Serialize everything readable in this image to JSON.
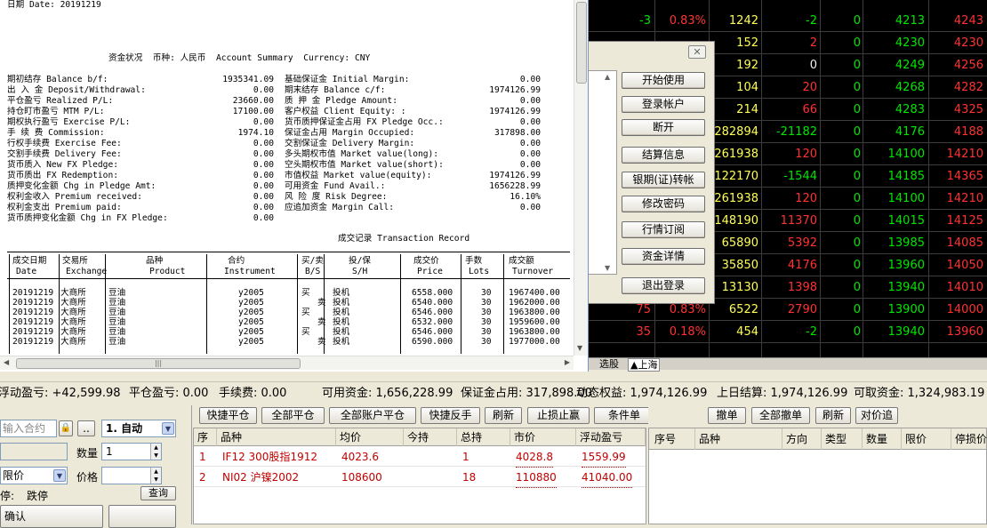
{
  "quote": {
    "rows": [
      [
        "",
        "-3",
        "0.83%",
        "1242",
        "-2",
        "0",
        "4213",
        "4243"
      ],
      [
        "",
        "",
        "",
        "152",
        "2",
        "0",
        "4230",
        "4230"
      ],
      [
        "",
        "",
        "",
        "192",
        "0",
        "0",
        "4249",
        "4256"
      ],
      [
        "",
        "",
        "",
        "104",
        "20",
        "0",
        "4268",
        "4282"
      ],
      [
        "",
        "",
        "",
        "214",
        "66",
        "0",
        "4283",
        "4325"
      ],
      [
        "",
        "",
        "",
        "282894",
        "-21182",
        "0",
        "4176",
        "4188"
      ],
      [
        "",
        "",
        "",
        "261938",
        "120",
        "0",
        "14100",
        "14210"
      ],
      [
        "",
        "",
        "",
        "122170",
        "-1544",
        "0",
        "14185",
        "14365"
      ],
      [
        "",
        "",
        "",
        "261938",
        "120",
        "0",
        "14100",
        "14210"
      ],
      [
        "",
        "",
        "",
        "148190",
        "11370",
        "0",
        "14015",
        "14125"
      ],
      [
        "",
        "",
        "",
        "65890",
        "5392",
        "0",
        "13985",
        "14085"
      ],
      [
        "",
        "",
        "",
        "35850",
        "4176",
        "0",
        "13960",
        "14050"
      ],
      [
        "",
        "",
        "",
        "13130",
        "1398",
        "0",
        "13940",
        "14010"
      ],
      [
        "",
        "75",
        "0.83%",
        "6522",
        "2790",
        "0",
        "13900",
        "14000"
      ],
      [
        "",
        "35",
        "0.18%",
        "454",
        "-2",
        "0",
        "13940",
        "13960"
      ]
    ],
    "tabs": [
      "选股",
      "▲上海"
    ]
  },
  "report": {
    "header": "日期 Date: 20191219",
    "summary_title": "资金状况  币种: 人民币  Account Summary  Currency: CNY",
    "left": [
      [
        "期初结存 Balance b/f:",
        "1935341.09"
      ],
      [
        "出 入 金 Deposit/Withdrawal:",
        "0.00"
      ],
      [
        "平仓盈亏 Realized P/L:",
        "23660.00"
      ],
      [
        "持仓盯市盈亏 MTM P/L:",
        "17100.00"
      ],
      [
        "期权执行盈亏 Exercise P/L:",
        "0.00"
      ],
      [
        "手 续 费 Commission:",
        "1974.10"
      ],
      [
        "行权手续费 Exercise Fee:",
        "0.00"
      ],
      [
        "交割手续费 Delivery Fee:",
        "0.00"
      ],
      [
        "货币质入 New FX Pledge:",
        "0.00"
      ],
      [
        "货币质出 FX Redemption:",
        "0.00"
      ],
      [
        "质押变化金额 Chg in Pledge Amt:",
        "0.00"
      ],
      [
        "权利金收入 Premium received:",
        "0.00"
      ],
      [
        "权利金支出 Premium paid:",
        "0.00"
      ],
      [
        "货币质押变化金额 Chg in FX Pledge:",
        "0.00"
      ]
    ],
    "right": [
      [
        "基础保证金 Initial Margin:",
        "0.00"
      ],
      [
        "期末结存 Balance c/f:",
        "1974126.99"
      ],
      [
        "质 押 金 Pledge Amount:",
        "0.00"
      ],
      [
        "客户权益 Client Equity: :",
        "1974126.99"
      ],
      [
        "货币质押保证金占用 FX Pledge Occ.:",
        "0.00"
      ],
      [
        "保证金占用 Margin Occupied:",
        "317898.00"
      ],
      [
        "交割保证金 Delivery Margin:",
        "0.00"
      ],
      [
        "多头期权市值 Market value(long):",
        "0.00"
      ],
      [
        "空头期权市值 Market value(short):",
        "0.00"
      ],
      [
        "市值权益 Market value(equity):",
        "1974126.99"
      ],
      [
        "可用资金 Fund Avail.:",
        "1656228.99"
      ],
      [
        "风 险 度 Risk Degree:",
        "16.10%"
      ],
      [
        "应追加资金 Margin Call:",
        "0.00"
      ]
    ],
    "trade_title": "成交记录 Transaction Record",
    "cols_cn": [
      "成交日期",
      "交易所",
      "品种",
      "合约",
      "买/卖",
      "投/保",
      "成交价",
      "手数",
      "成交额"
    ],
    "cols_en": [
      "Date",
      "Exchange",
      "Product",
      "Instrument",
      "B/S",
      "S/H",
      "Price",
      "Lots",
      "Turnover"
    ],
    "trades": [
      [
        "20191219",
        "大商所",
        "豆油",
        "y2005",
        "买",
        "投机",
        "6558.000",
        "30",
        "1967400.00"
      ],
      [
        "20191219",
        "大商所",
        "豆油",
        "y2005",
        "卖",
        "投机",
        "6540.000",
        "30",
        "1962000.00"
      ],
      [
        "20191219",
        "大商所",
        "豆油",
        "y2005",
        "买",
        "投机",
        "6546.000",
        "30",
        "1963800.00"
      ],
      [
        "20191219",
        "大商所",
        "豆油",
        "y2005",
        "卖",
        "投机",
        "6532.000",
        "30",
        "1959600.00"
      ],
      [
        "20191219",
        "大商所",
        "豆油",
        "y2005",
        "买",
        "投机",
        "6546.000",
        "30",
        "1963800.00"
      ],
      [
        "20191219",
        "大商所",
        "豆油",
        "y2005",
        "卖",
        "投机",
        "6590.000",
        "30",
        "1977000.00"
      ]
    ]
  },
  "dialog": {
    "buttons": [
      "开始使用",
      "登录帐户",
      "断开",
      "结算信息",
      "银期(证)转帐",
      "修改密码",
      "行情订阅",
      "资金详情",
      "退出登录"
    ]
  },
  "status": [
    "浮动盈亏: +42,599.98",
    "平仓盈亏: 0.00",
    "手续费: 0.00",
    "可用资金: 1,656,228.99",
    "保证金占用: 317,898.00",
    "动态权益: 1,974,126.99",
    "上日结算: 1,974,126.99",
    "可取资金: 1,324,983.19"
  ],
  "order_panel": {
    "contract_placeholder": "输入合约",
    "more": "..",
    "mode": "1. 自动",
    "qty_label": "数量",
    "qty": "1",
    "price_type": "限价",
    "price_label": "价格",
    "stop_label": "停:",
    "stop_value": "跌停",
    "query": "查询",
    "confirm": "确认"
  },
  "positions": {
    "toolbar": [
      "快捷平仓",
      "全部平仓",
      "全部账户平仓",
      "快捷反手",
      "刷新",
      "止损止赢",
      "条件单"
    ],
    "columns": [
      "序",
      "品种",
      "均价",
      "今持",
      "总持",
      "市价",
      "浮动盈亏"
    ],
    "rows": [
      [
        "1",
        "IF12 300股指1912",
        "4023.6",
        "",
        "1",
        "4028.8",
        "1559.99"
      ],
      [
        "2",
        "NI02 沪镍2002",
        "108600",
        "",
        "18",
        "110880",
        "41040.00"
      ]
    ]
  },
  "orders": {
    "toolbar": [
      "撤单",
      "全部撤单",
      "刷新",
      "对价追"
    ],
    "columns": [
      "序号",
      "品种",
      "方向",
      "类型",
      "数量",
      "限价",
      "停损价"
    ]
  }
}
